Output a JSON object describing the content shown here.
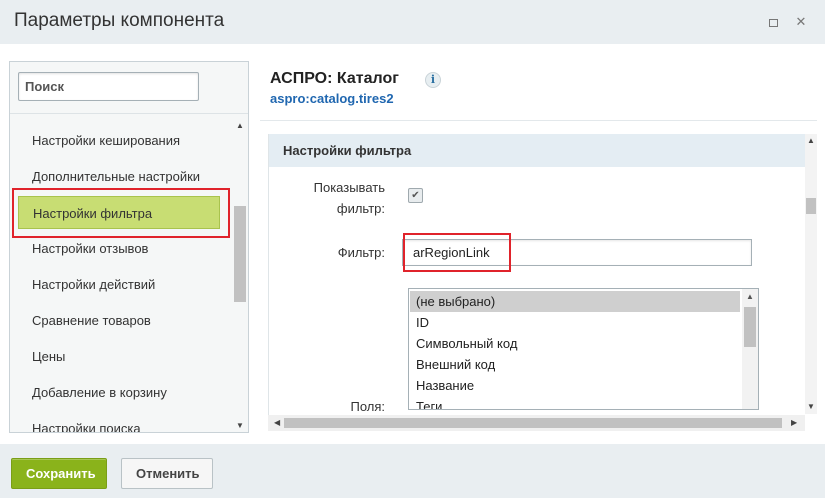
{
  "window": {
    "title": "Параметры компонента"
  },
  "sidebar": {
    "search_placeholder": "Поиск",
    "items": [
      {
        "label": "Настройки кеширования"
      },
      {
        "label": "Дополнительные настройки"
      },
      {
        "label": "Настройки фильтра",
        "active": true
      },
      {
        "label": "Настройки отзывов"
      },
      {
        "label": "Настройки действий"
      },
      {
        "label": "Сравнение товаров"
      },
      {
        "label": "Цены"
      },
      {
        "label": "Добавление в корзину"
      },
      {
        "label": "Настройки поиска"
      }
    ]
  },
  "component": {
    "title": "АСПРО: Каталог",
    "code": "aspro:catalog.tires2"
  },
  "section": {
    "title": "Настройки фильтра",
    "show_filter_label_line1": "Показывать",
    "show_filter_label_line2": "фильтр:",
    "show_filter_checked": true,
    "filter_label": "Фильтр:",
    "filter_value": "arRegionLink",
    "fields_label": "Поля:",
    "fields_options": [
      {
        "label": "(не выбрано)",
        "selected": true
      },
      {
        "label": "ID"
      },
      {
        "label": "Символьный код"
      },
      {
        "label": "Внешний код"
      },
      {
        "label": "Название"
      },
      {
        "label": "Теги"
      }
    ]
  },
  "footer": {
    "save_label": "Сохранить",
    "cancel_label": "Отменить"
  },
  "colors": {
    "active_item": "#c8dd73",
    "highlight_border": "#e0232b",
    "save_button": "#8ab31b",
    "link_code": "#2067b0",
    "section_header": "#e4edf3"
  }
}
